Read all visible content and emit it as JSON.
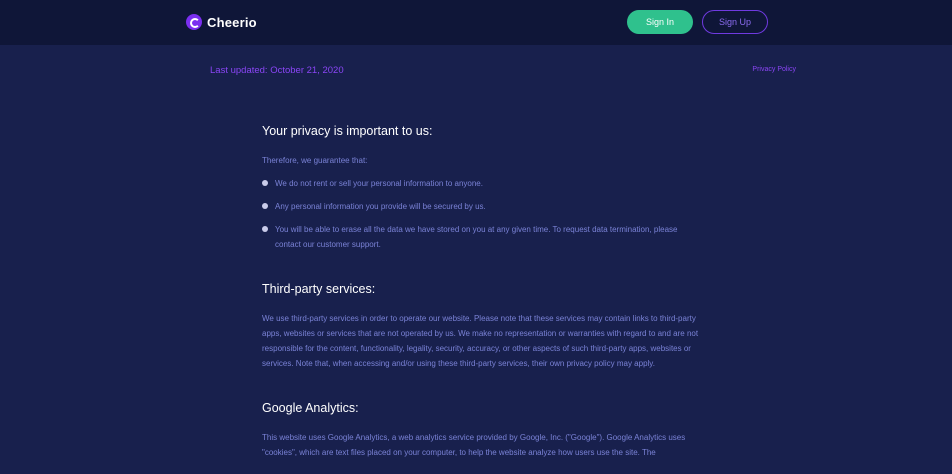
{
  "brand": {
    "name": "Cheerio",
    "logo_icon": "cheerio-c-logo",
    "accent_color": "#7b2ff0"
  },
  "header": {
    "sign_in_label": "Sign In",
    "sign_up_label": "Sign Up",
    "sign_in_color": "#2fc18d"
  },
  "meta": {
    "last_updated": "Last updated: October 21, 2020",
    "privacy_policy_link": "Privacy Policy"
  },
  "sections": {
    "privacy": {
      "heading": "Your privacy is important to us:",
      "intro": "Therefore, we guarantee that:",
      "bullets": [
        "We do not rent or sell your personal information to anyone.",
        "Any personal information you provide will be secured by us.",
        "You will be able to erase all the data we have stored on you at any given time. To request data termination, please contact our customer support."
      ]
    },
    "third_party": {
      "heading": "Third-party services:",
      "body": "We use third-party services in order to operate our website. Please note that these services may contain links to third-party apps, websites or services that are not operated by us. We make no representation or warranties with regard to and are not responsible for the content, functionality, legality, security, accuracy, or other aspects of such third-party apps, websites or services. Note that, when accessing and/or using these third-party services, their own privacy policy may apply."
    },
    "google_analytics": {
      "heading": "Google Analytics:",
      "body": "This website uses Google Analytics, a web analytics service provided by Google, Inc. (\"Google\"). Google Analytics uses \"cookies\", which are text files placed on your computer, to help the website analyze how users use the site. The"
    }
  }
}
